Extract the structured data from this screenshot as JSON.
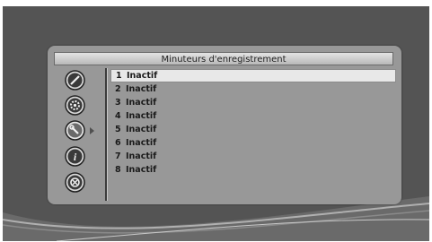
{
  "screen": {
    "title": "Minuteurs d'enregistrement"
  },
  "sidebar": {
    "icons": [
      {
        "name": "edit-icon"
      },
      {
        "name": "settings-gear-icon"
      },
      {
        "name": "tools-wrench-icon",
        "selected": true
      },
      {
        "name": "info-icon"
      },
      {
        "name": "satellite-dish-icon"
      }
    ]
  },
  "timers": [
    {
      "number": "1",
      "status": "Inactif",
      "selected": true
    },
    {
      "number": "2",
      "status": "Inactif"
    },
    {
      "number": "3",
      "status": "Inactif"
    },
    {
      "number": "4",
      "status": "Inactif"
    },
    {
      "number": "5",
      "status": "Inactif"
    },
    {
      "number": "6",
      "status": "Inactif"
    },
    {
      "number": "7",
      "status": "Inactif"
    },
    {
      "number": "8",
      "status": "Inactif"
    }
  ]
}
